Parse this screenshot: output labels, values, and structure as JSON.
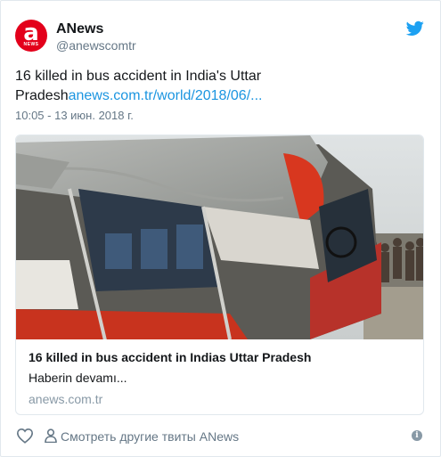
{
  "author": {
    "display_name": "ANews",
    "handle": "@anewscomtr",
    "avatar_letter": "a",
    "avatar_sub": "NEWS",
    "brand_color": "#e3001b"
  },
  "tweet": {
    "text_prefix": "16 killed in bus accident in India's Uttar Pradesh",
    "link_text": "anews.com.tr/world/2018/06/...",
    "timestamp": "10:05 - 13 июн. 2018 г."
  },
  "card": {
    "image_icon": "bus-accident-photo",
    "title": "16 killed in bus accident in Indias Uttar Pradesh",
    "description": "Haberin devamı...",
    "domain": "anews.com.tr"
  },
  "footer": {
    "like_icon": "heart-icon",
    "more_tweets_label": "Смотреть другие твиты ANews",
    "info_glyph": "i"
  },
  "colors": {
    "link": "#1b95e0",
    "secondary_text": "#657786",
    "twitter_blue": "#1da1f2"
  }
}
